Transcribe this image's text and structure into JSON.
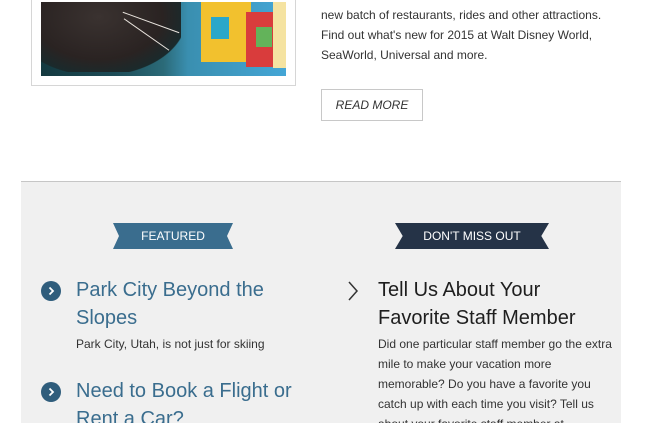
{
  "article": {
    "intro_text": "new batch of restaurants, rides and other attractions. Find out what's new for 2015 at Walt Disney World, SeaWorld, Universal and more.",
    "read_more_label": "READ MORE"
  },
  "featured": {
    "ribbon_label": "FEATURED",
    "items": [
      {
        "title": "Park City Beyond the Slopes",
        "description": "Park City, Utah, is not just for skiing"
      },
      {
        "title": "Need to Book a Flight or Rent a Car?"
      }
    ]
  },
  "dont_miss": {
    "ribbon_label": "DON'T MISS OUT",
    "title": "Tell Us About Your Favorite Staff Member",
    "description": "Did one particular staff member go the extra mile to make your vacation more memorable? Do you have a favorite you catch up with each time you visit? Tell us about your favorite staff member at"
  },
  "colors": {
    "featured_ribbon": "#3a6d8e",
    "dont_miss_ribbon": "#253347",
    "link_blue": "#3a6d8e",
    "panel_bg": "#f0f0f0"
  },
  "icons": {
    "featured_bullet": "chevron-right-circle-icon",
    "dont_miss_bullet": "chevron-right-icon"
  }
}
